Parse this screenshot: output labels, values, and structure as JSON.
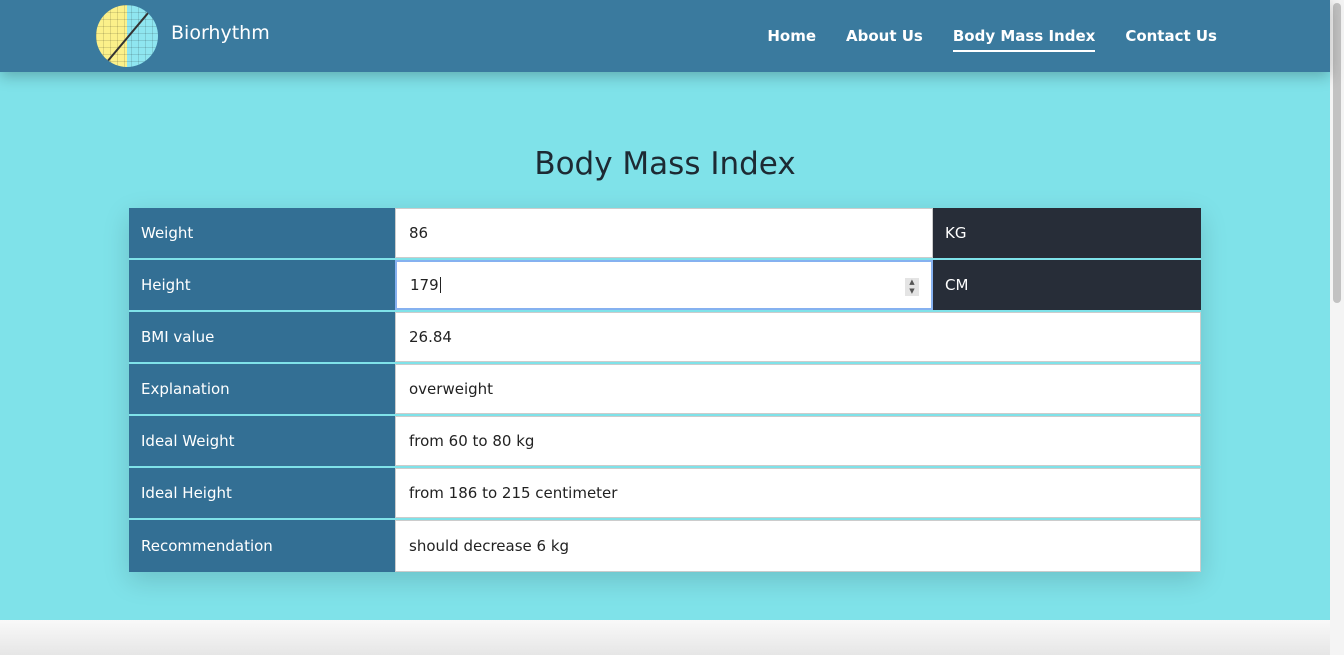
{
  "brand": "Biorhythm",
  "nav": [
    "Home",
    "About Us",
    "Body Mass Index",
    "Contact Us"
  ],
  "title": "Body Mass Index",
  "rows": [
    {
      "label": "Weight",
      "value": "86",
      "unit": "KG"
    },
    {
      "label": "Height",
      "value": "179",
      "unit": "CM"
    },
    {
      "label": "BMI value",
      "value": "26.84"
    },
    {
      "label": "Explanation",
      "value": "overweight"
    },
    {
      "label": "Ideal Weight",
      "value": "from 60 to 80 kg"
    },
    {
      "label": "Ideal Height",
      "value": "from 186 to 215 centimeter"
    },
    {
      "label": "Recommendation",
      "value": "should decrease 6 kg"
    }
  ]
}
